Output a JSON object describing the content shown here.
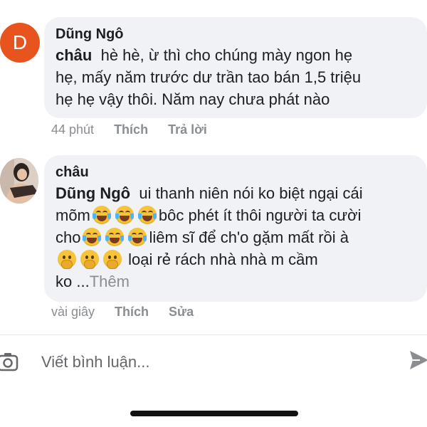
{
  "comments": [
    {
      "avatar_letter": "D",
      "author": "Dũng Ngô",
      "mention": "châu",
      "line1": "hè hè, ừ thì cho chúng mày ngon hẹ",
      "line2": "hẹ, mấy năm trước dư trần tao bán 1,5 triệu",
      "line3": "hẹ hẹ vậy thôi. Năm nay chưa phát nào",
      "time": "44 phút",
      "like": "Thích",
      "reply": "Trả lời"
    },
    {
      "author": "châu",
      "mention": "Dũng Ngô",
      "line1": "ui thanh niên nói ko biệt ngại cái",
      "line2_text": "mõm",
      "line2_after": "bôc phét ít thôi người ta cười",
      "line3_text": "cho",
      "line3_after": "liêm sĩ để ch'o gặm mất rồi à",
      "line4_after": "loại rẻ rách nhà nhà m cầm",
      "line5_text": "ko ...",
      "more": "Thêm",
      "time": "vài giây",
      "like": "Thích",
      "edit": "Sửa"
    }
  ],
  "composer": {
    "placeholder": "Viết bình luận..."
  },
  "icons": {
    "emoji_laugh": "face-with-tears-of-joy",
    "emoji_hand": "face-with-hand-over-mouth",
    "camera": "camera-icon",
    "send": "send-icon"
  },
  "colors": {
    "avatar_bg": "#e8541e",
    "bubble_bg": "#f0f2f5",
    "meta": "#8a8d91"
  }
}
